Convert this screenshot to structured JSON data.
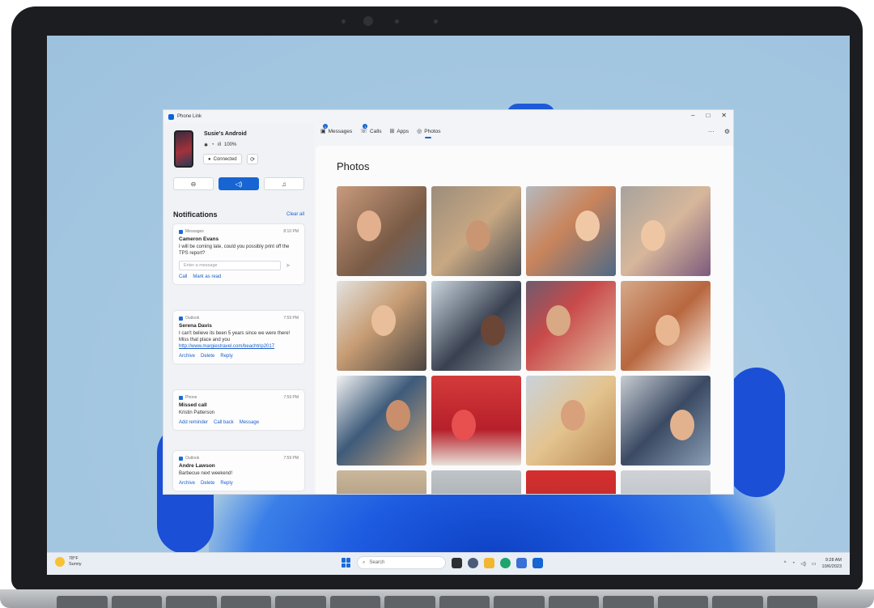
{
  "window": {
    "title": "Phone Link",
    "controls": {
      "minimize": "–",
      "maximize": "□",
      "close": "✕"
    }
  },
  "device": {
    "name": "Susie's Android",
    "bluetooth": "✱",
    "wifi": "◔",
    "signal": "ıll",
    "battery": "100%",
    "status": "Connected",
    "sync_icon": "⟳"
  },
  "quick_actions": [
    {
      "name": "do-not-disturb",
      "icon": "⊖"
    },
    {
      "name": "audio",
      "icon": "◁)"
    },
    {
      "name": "music",
      "icon": "♫"
    }
  ],
  "notifications": {
    "header": "Notifications",
    "clear_all": "Clear all",
    "cards": [
      {
        "app": "Messages",
        "time": "8:10 PM",
        "sender": "Cameron Evans",
        "body": "I will be coming late, could you possibly print off the TPS report?",
        "reply_placeholder": "Enter a message",
        "actions": [
          "Call",
          "Mark as read"
        ]
      },
      {
        "app": "Outlook",
        "time": "7:59 PM",
        "sender": "Serena Davis",
        "body": "I can't believe its been 5 years since we were there! Miss that place and you",
        "link": "http://www.margiestravel.com/beachtrip2017",
        "actions": [
          "Archive",
          "Delete",
          "Reply"
        ]
      },
      {
        "app": "Phone",
        "time": "7:59 PM",
        "sender": "Missed call",
        "body": "Kristin Patterson",
        "actions": [
          "Add reminder",
          "Call back",
          "Message"
        ]
      },
      {
        "app": "Outlook",
        "time": "7:59 PM",
        "sender": "Andre Lawson",
        "body": "Barbecue next weekend!",
        "actions": [
          "Archive",
          "Delete",
          "Reply"
        ]
      }
    ]
  },
  "tabs": [
    {
      "label": "Messages",
      "icon": "▣",
      "badge": "1"
    },
    {
      "label": "Calls",
      "icon": "☏",
      "badge": "1"
    },
    {
      "label": "Apps",
      "icon": "⊞",
      "badge": ""
    },
    {
      "label": "Photos",
      "icon": "◎",
      "badge": ""
    }
  ],
  "header_icons": {
    "more": "···",
    "settings": "⚙"
  },
  "photos": {
    "title": "Photos",
    "tiles": [
      {
        "bg": "linear-gradient(135deg,#c89a7c,#7a5b46 60%,#5d6b7a)",
        "face": "#e2b08e"
      },
      {
        "bg": "linear-gradient(135deg,#9c8d7c,#c8a882 50%,#4b4e55)",
        "face": "#c99573"
      },
      {
        "bg": "linear-gradient(135deg,#b5b9bf,#c9845b 45%,#4e6a86)",
        "face": "#f0c8a6"
      },
      {
        "bg": "linear-gradient(135deg,#a7a39d,#d7b79b 50%,#7c5a7d)",
        "face": "#efc6a4"
      },
      {
        "bg": "linear-gradient(135deg,#e2e2e0,#c79d74 45%,#4a4440)",
        "face": "#e9bf9b"
      },
      {
        "bg": "linear-gradient(135deg,#c9d5dd,#394050 55%,#8a9299)",
        "face": "#6b4636"
      },
      {
        "bg": "linear-gradient(135deg,#6e5b6e,#c94a4a 40%,#e2c0a0)",
        "face": "#d9a884"
      },
      {
        "bg": "linear-gradient(135deg,#d5a98a,#b8673f 50%,#fff8f0)",
        "face": "#e8b792"
      },
      {
        "bg": "linear-gradient(135deg,#f2f2f2,#3e5b7a 45%,#c9a37b)",
        "face": "#c98e6b"
      },
      {
        "bg": "linear-gradient(180deg,#d33b3b,#b71f2a 60%,#e8e2da)",
        "face": "#e85050"
      },
      {
        "bg": "linear-gradient(135deg,#c9d3dc,#e4c38e 50%,#b98a56)",
        "face": "#d9a07c"
      },
      {
        "bg": "linear-gradient(135deg,#c7ccd2,#3b4a63 50%,#8a9eb5)",
        "face": "#e2b28e"
      },
      {
        "bg": "linear-gradient(180deg,#c9b79c,#8b6f54)",
        "face": "#d9b592"
      },
      {
        "bg": "linear-gradient(180deg,#bfc4c8,#8b8d90)",
        "face": "#c7a185"
      },
      {
        "bg": "linear-gradient(180deg,#d62e2e,#9c2b2b)",
        "face": "#e9a98f"
      },
      {
        "bg": "linear-gradient(180deg,#cfd3d8,#a6a9ad)",
        "face": "#d8b396"
      }
    ]
  },
  "taskbar": {
    "weather_temp": "78°F",
    "weather_desc": "Sunny",
    "search_placeholder": "Search",
    "search_icon": "⌕",
    "tray": {
      "chevron": "^",
      "wifi": "◔",
      "volume": "◁)",
      "battery": "▭"
    },
    "time": "9:28 AM",
    "date": "10/6/2023"
  }
}
